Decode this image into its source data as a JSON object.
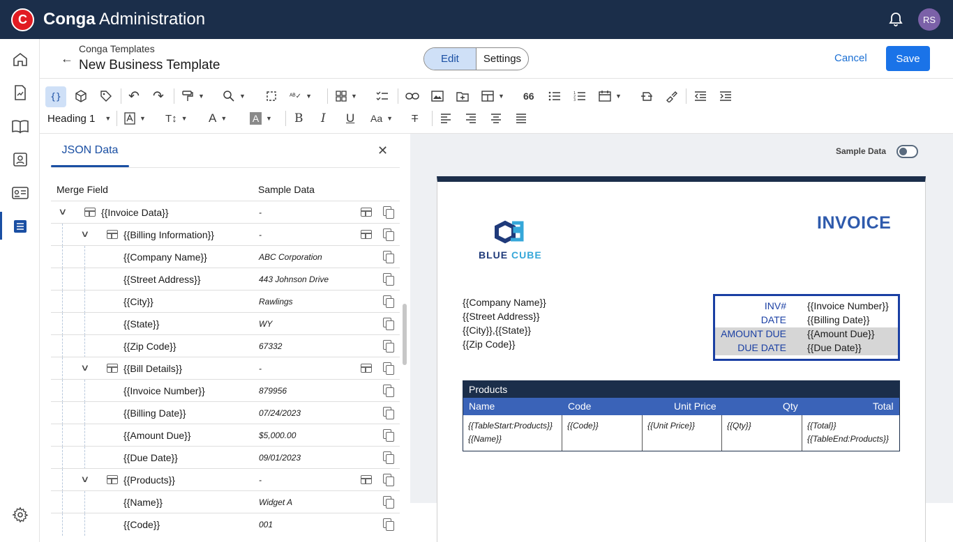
{
  "app": {
    "logo_letter": "C",
    "brand": "Conga",
    "title": "Administration",
    "user_initials": "RS"
  },
  "header": {
    "breadcrumb": "Conga Templates",
    "title": "New Business Template",
    "tabs": [
      "Edit",
      "Settings"
    ],
    "cancel_label": "Cancel",
    "save_label": "Save"
  },
  "toolbar": {
    "style_select": "Heading 1",
    "counter_label": "66"
  },
  "panel": {
    "tab_label": "JSON Data",
    "col_merge": "Merge Field",
    "col_sample": "Sample Data",
    "rows": [
      {
        "field": "{{Invoice Data}}",
        "sample": "-"
      },
      {
        "field": "{{Billing Information}}",
        "sample": "-"
      },
      {
        "field": "{{Company Name}}",
        "sample": "ABC Corporation"
      },
      {
        "field": "{{Street Address}}",
        "sample": "443 Johnson Drive"
      },
      {
        "field": "{{City}}",
        "sample": "Rawlings"
      },
      {
        "field": "{{State}}",
        "sample": "WY"
      },
      {
        "field": "{{Zip Code}}",
        "sample": "67332"
      },
      {
        "field": "{{Bill Details}}",
        "sample": "-"
      },
      {
        "field": "{{Invoice Number}}",
        "sample": "879956"
      },
      {
        "field": "{{Billing Date}}",
        "sample": "07/24/2023"
      },
      {
        "field": "{{Amount Due}}",
        "sample": "$5,000.00"
      },
      {
        "field": "{{Due Date}}",
        "sample": "09/01/2023"
      },
      {
        "field": "{{Products}}",
        "sample": "-"
      },
      {
        "field": "{{Name}}",
        "sample": "Widget A"
      },
      {
        "field": "{{Code}}",
        "sample": "001"
      }
    ]
  },
  "preview": {
    "sample_data_label": "Sample Data",
    "sample_data_on": false,
    "brand_word1": "BLUE",
    "brand_word2": "CUBE",
    "invoice_title": "INVOICE",
    "address_lines": [
      "{{Company Name}}",
      "{{Street Address}}",
      "{{City}},{{State}}",
      "{{Zip Code}}"
    ],
    "info": [
      {
        "key": "INV#",
        "value": "{{Invoice Number}}"
      },
      {
        "key": "DATE",
        "value": "{{Billing Date}}"
      },
      {
        "key": "AMOUNT DUE",
        "value": "{{Amount Due}}"
      },
      {
        "key": "DUE DATE",
        "value": "{{Due Date}}"
      }
    ],
    "products": {
      "title": "Products",
      "headers": [
        "Name",
        "Code",
        "Unit Price",
        "Qty",
        "Total"
      ],
      "cells": [
        [
          "{{TableStart:Products}}",
          "{{Name}}"
        ],
        [
          "{{Code}}"
        ],
        [
          "{{Unit Price}}"
        ],
        [
          "{{Qty}}"
        ],
        [
          "{{Total}}",
          "{{TableEnd:Products}}"
        ]
      ]
    }
  },
  "colors": {
    "topbar": "#1b2e4a",
    "accent": "#1a4fa3",
    "save": "#1a73e8",
    "invoice_blue": "#2e5aac"
  }
}
